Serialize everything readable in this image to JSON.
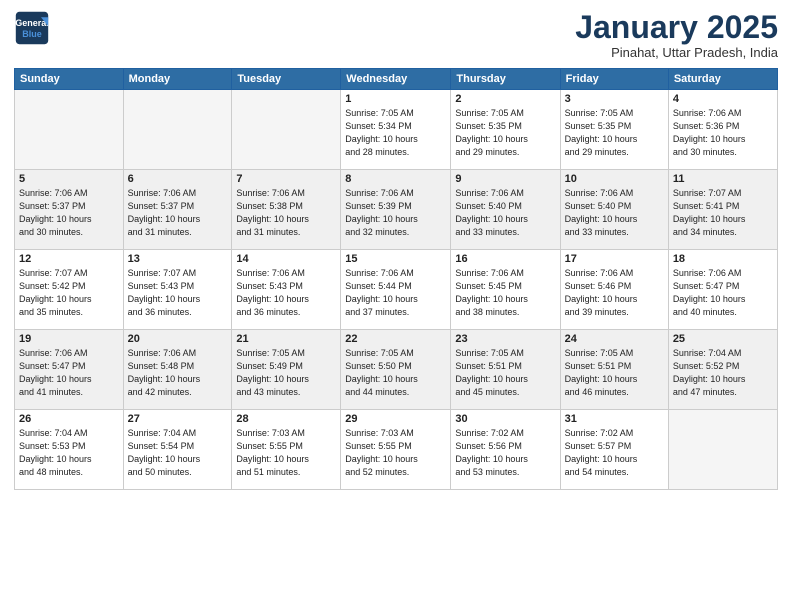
{
  "logo": {
    "line1": "General",
    "line2": "Blue"
  },
  "header": {
    "month": "January 2025",
    "location": "Pinahat, Uttar Pradesh, India"
  },
  "weekdays": [
    "Sunday",
    "Monday",
    "Tuesday",
    "Wednesday",
    "Thursday",
    "Friday",
    "Saturday"
  ],
  "weeks": [
    {
      "shaded": false,
      "days": [
        {
          "num": "",
          "info": ""
        },
        {
          "num": "",
          "info": ""
        },
        {
          "num": "",
          "info": ""
        },
        {
          "num": "1",
          "info": "Sunrise: 7:05 AM\nSunset: 5:34 PM\nDaylight: 10 hours\nand 28 minutes."
        },
        {
          "num": "2",
          "info": "Sunrise: 7:05 AM\nSunset: 5:35 PM\nDaylight: 10 hours\nand 29 minutes."
        },
        {
          "num": "3",
          "info": "Sunrise: 7:05 AM\nSunset: 5:35 PM\nDaylight: 10 hours\nand 29 minutes."
        },
        {
          "num": "4",
          "info": "Sunrise: 7:06 AM\nSunset: 5:36 PM\nDaylight: 10 hours\nand 30 minutes."
        }
      ]
    },
    {
      "shaded": true,
      "days": [
        {
          "num": "5",
          "info": "Sunrise: 7:06 AM\nSunset: 5:37 PM\nDaylight: 10 hours\nand 30 minutes."
        },
        {
          "num": "6",
          "info": "Sunrise: 7:06 AM\nSunset: 5:37 PM\nDaylight: 10 hours\nand 31 minutes."
        },
        {
          "num": "7",
          "info": "Sunrise: 7:06 AM\nSunset: 5:38 PM\nDaylight: 10 hours\nand 31 minutes."
        },
        {
          "num": "8",
          "info": "Sunrise: 7:06 AM\nSunset: 5:39 PM\nDaylight: 10 hours\nand 32 minutes."
        },
        {
          "num": "9",
          "info": "Sunrise: 7:06 AM\nSunset: 5:40 PM\nDaylight: 10 hours\nand 33 minutes."
        },
        {
          "num": "10",
          "info": "Sunrise: 7:06 AM\nSunset: 5:40 PM\nDaylight: 10 hours\nand 33 minutes."
        },
        {
          "num": "11",
          "info": "Sunrise: 7:07 AM\nSunset: 5:41 PM\nDaylight: 10 hours\nand 34 minutes."
        }
      ]
    },
    {
      "shaded": false,
      "days": [
        {
          "num": "12",
          "info": "Sunrise: 7:07 AM\nSunset: 5:42 PM\nDaylight: 10 hours\nand 35 minutes."
        },
        {
          "num": "13",
          "info": "Sunrise: 7:07 AM\nSunset: 5:43 PM\nDaylight: 10 hours\nand 36 minutes."
        },
        {
          "num": "14",
          "info": "Sunrise: 7:06 AM\nSunset: 5:43 PM\nDaylight: 10 hours\nand 36 minutes."
        },
        {
          "num": "15",
          "info": "Sunrise: 7:06 AM\nSunset: 5:44 PM\nDaylight: 10 hours\nand 37 minutes."
        },
        {
          "num": "16",
          "info": "Sunrise: 7:06 AM\nSunset: 5:45 PM\nDaylight: 10 hours\nand 38 minutes."
        },
        {
          "num": "17",
          "info": "Sunrise: 7:06 AM\nSunset: 5:46 PM\nDaylight: 10 hours\nand 39 minutes."
        },
        {
          "num": "18",
          "info": "Sunrise: 7:06 AM\nSunset: 5:47 PM\nDaylight: 10 hours\nand 40 minutes."
        }
      ]
    },
    {
      "shaded": true,
      "days": [
        {
          "num": "19",
          "info": "Sunrise: 7:06 AM\nSunset: 5:47 PM\nDaylight: 10 hours\nand 41 minutes."
        },
        {
          "num": "20",
          "info": "Sunrise: 7:06 AM\nSunset: 5:48 PM\nDaylight: 10 hours\nand 42 minutes."
        },
        {
          "num": "21",
          "info": "Sunrise: 7:05 AM\nSunset: 5:49 PM\nDaylight: 10 hours\nand 43 minutes."
        },
        {
          "num": "22",
          "info": "Sunrise: 7:05 AM\nSunset: 5:50 PM\nDaylight: 10 hours\nand 44 minutes."
        },
        {
          "num": "23",
          "info": "Sunrise: 7:05 AM\nSunset: 5:51 PM\nDaylight: 10 hours\nand 45 minutes."
        },
        {
          "num": "24",
          "info": "Sunrise: 7:05 AM\nSunset: 5:51 PM\nDaylight: 10 hours\nand 46 minutes."
        },
        {
          "num": "25",
          "info": "Sunrise: 7:04 AM\nSunset: 5:52 PM\nDaylight: 10 hours\nand 47 minutes."
        }
      ]
    },
    {
      "shaded": false,
      "days": [
        {
          "num": "26",
          "info": "Sunrise: 7:04 AM\nSunset: 5:53 PM\nDaylight: 10 hours\nand 48 minutes."
        },
        {
          "num": "27",
          "info": "Sunrise: 7:04 AM\nSunset: 5:54 PM\nDaylight: 10 hours\nand 50 minutes."
        },
        {
          "num": "28",
          "info": "Sunrise: 7:03 AM\nSunset: 5:55 PM\nDaylight: 10 hours\nand 51 minutes."
        },
        {
          "num": "29",
          "info": "Sunrise: 7:03 AM\nSunset: 5:55 PM\nDaylight: 10 hours\nand 52 minutes."
        },
        {
          "num": "30",
          "info": "Sunrise: 7:02 AM\nSunset: 5:56 PM\nDaylight: 10 hours\nand 53 minutes."
        },
        {
          "num": "31",
          "info": "Sunrise: 7:02 AM\nSunset: 5:57 PM\nDaylight: 10 hours\nand 54 minutes."
        },
        {
          "num": "",
          "info": ""
        }
      ]
    }
  ]
}
